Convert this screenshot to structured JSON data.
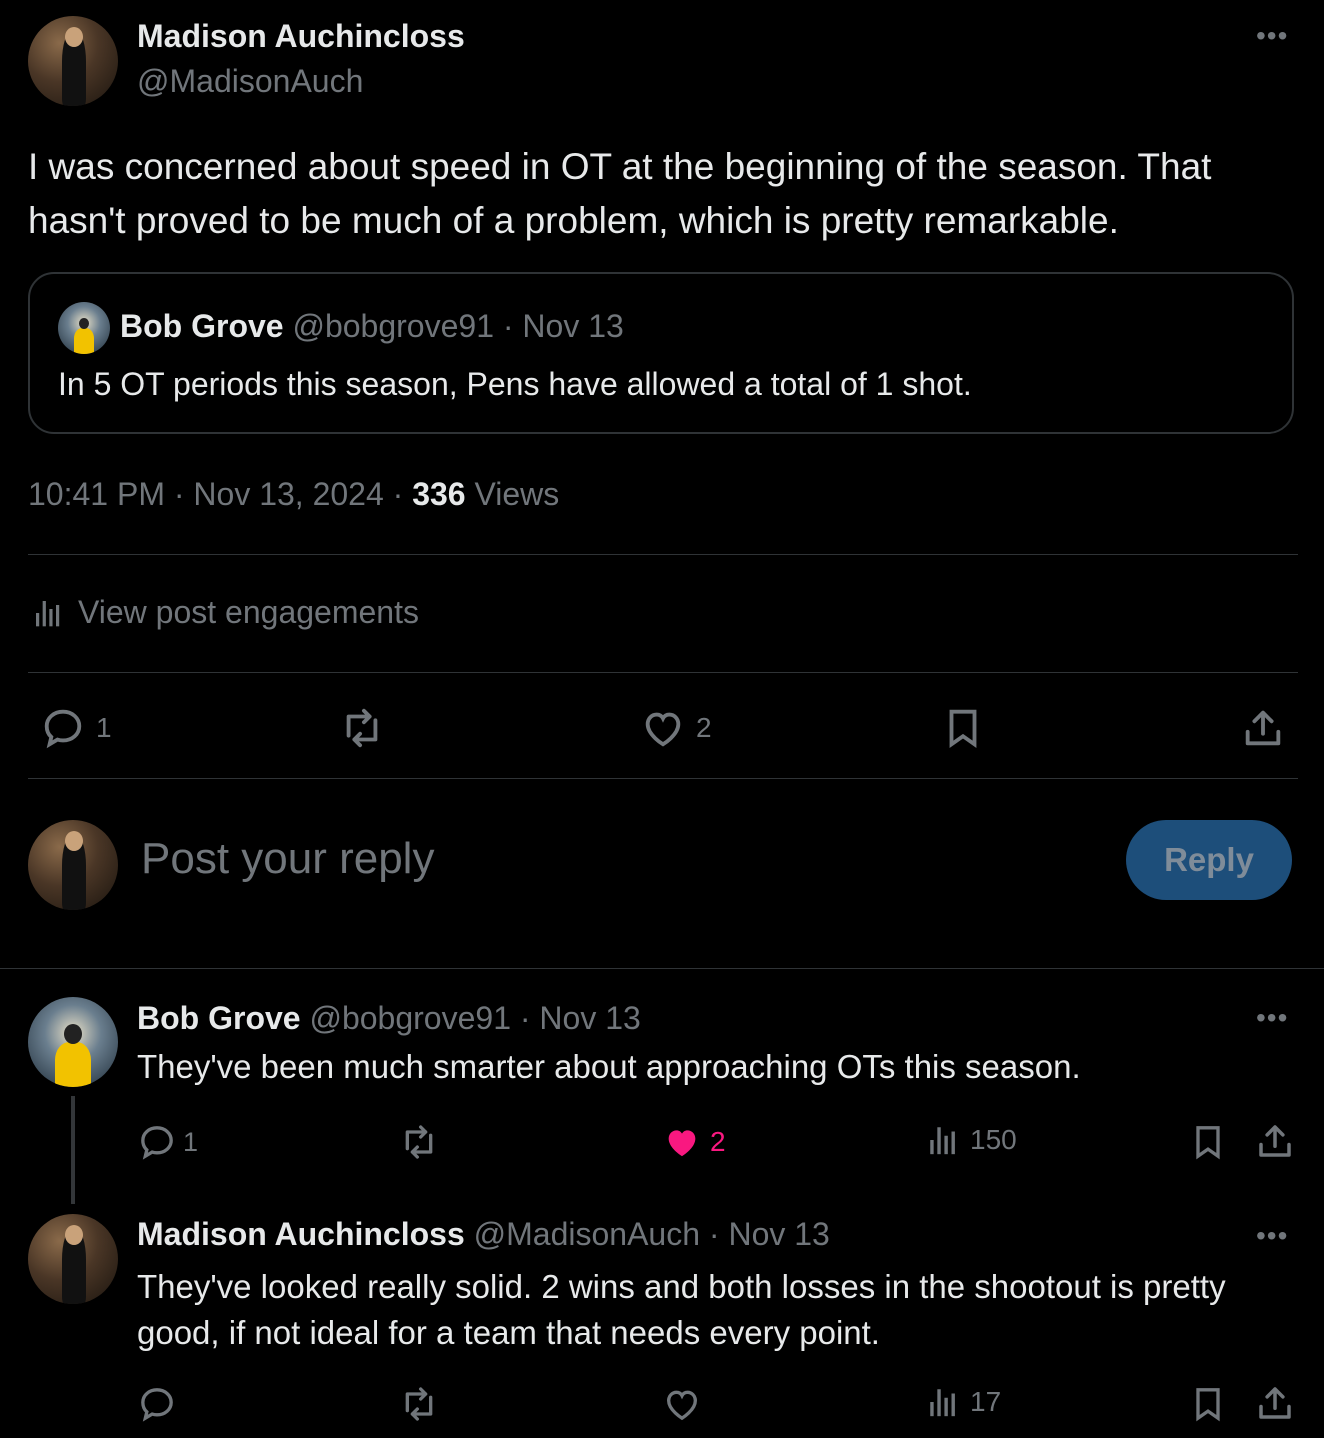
{
  "main_post": {
    "author_name": "Madison Auchincloss",
    "author_handle": "@MadisonAuch",
    "text": "I was concerned about speed in OT at the beginning of the season. That hasn't proved to be much of a problem, which is pretty remarkable.",
    "quote": {
      "author_name": "Bob Grove",
      "author_handle": "@bobgrove91",
      "date": "· Nov 13",
      "text": "In 5 OT periods this season, Pens have allowed a total of 1 shot."
    },
    "timestamp": "10:41 PM · Nov 13, 2024 · ",
    "views_count": "336",
    "views_label": " Views",
    "engagements_label": "View post engagements",
    "reply_count": "1",
    "like_count": "2"
  },
  "composer": {
    "placeholder": "Post your reply",
    "reply_button": "Reply"
  },
  "replies": [
    {
      "author_name": "Bob Grove",
      "author_handle": "@bobgrove91",
      "date": "· Nov 13",
      "text": "They've been much smarter about approaching OTs this season.",
      "reply_count": "1",
      "like_count": "2",
      "views": "150"
    },
    {
      "author_name": "Madison Auchincloss",
      "author_handle": "@MadisonAuch",
      "date": "· Nov 13",
      "text": "They've looked really solid. 2 wins and both losses in the shootout is pretty good, if not ideal for a team that needs every point.",
      "views": "17"
    }
  ],
  "colors": {
    "background": "#000000",
    "text": "#e7e9ea",
    "muted": "#71767b",
    "divider": "#2f3336",
    "like_active": "#f91880",
    "reply_button_bg": "#1d4e7a"
  },
  "icons": {
    "more": "more-icon",
    "reply": "reply-icon",
    "repost": "repost-icon",
    "like": "heart-icon",
    "bookmark": "bookmark-icon",
    "share": "share-icon",
    "analytics": "analytics-icon"
  }
}
